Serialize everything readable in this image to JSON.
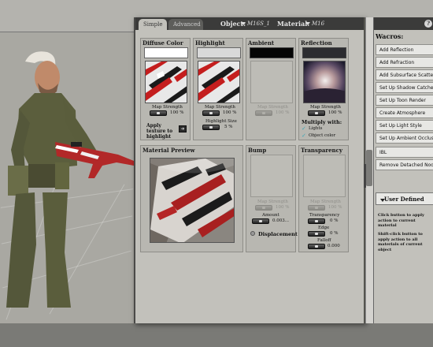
{
  "tabs": {
    "simple": "Simple",
    "advanced": "Advanced"
  },
  "header": {
    "object_label": "Object:",
    "object_value": "M16S_1",
    "material_label": "Material:",
    "material_value": "M16"
  },
  "diffuse": {
    "title": "Diffuse Color",
    "map_label": "Map Strength",
    "map_value": "100 %",
    "apply_label": "Apply texture to highlight"
  },
  "highlight": {
    "title": "Highlight",
    "map_label": "Map Strength",
    "map_value": "100 %",
    "size_label": "Highlight Size",
    "size_value": "5 %"
  },
  "ambient": {
    "title": "Ambient",
    "map_label": "Map Strength",
    "map_value": "100 %"
  },
  "reflection": {
    "title": "Reflection",
    "map_label": "Map Strength",
    "map_value": "100 %",
    "multiply_label": "Multiply with:",
    "lights_label": "Lights",
    "object_color_label": "Object color"
  },
  "preview": {
    "title": "Material Preview"
  },
  "bump": {
    "title": "Bump",
    "map_label": "Map Strength",
    "map_value": "100 %",
    "amount_label": "Amount",
    "amount_value": "0.003...",
    "displacement_label": "Displacement"
  },
  "transparency": {
    "title": "Transparency",
    "map_label": "Map Strength",
    "map_value": "100 %",
    "trans_label": "Transparency",
    "trans_value": "0 %",
    "edge_label": "Edge",
    "edge_value": "0 %",
    "falloff_label": "Falloff",
    "falloff_value": "0.000"
  },
  "wacros": {
    "title": "Wacros:",
    "buttons": [
      "Add Reflection",
      "Add Refraction",
      "Add Subsurface Scattering",
      "Set Up Shadow Catcher",
      "Set Up Toon Render",
      "Create Atmosphere",
      "Set Up Light Style",
      "Set Up Ambient Occlusion",
      "IBL",
      "Remove Detached Nodes"
    ],
    "user_defined": "User Defined",
    "note1": "Click button to apply action to current material",
    "note2": "Shift-click button to apply action to all materials of current object"
  },
  "help": "?"
}
